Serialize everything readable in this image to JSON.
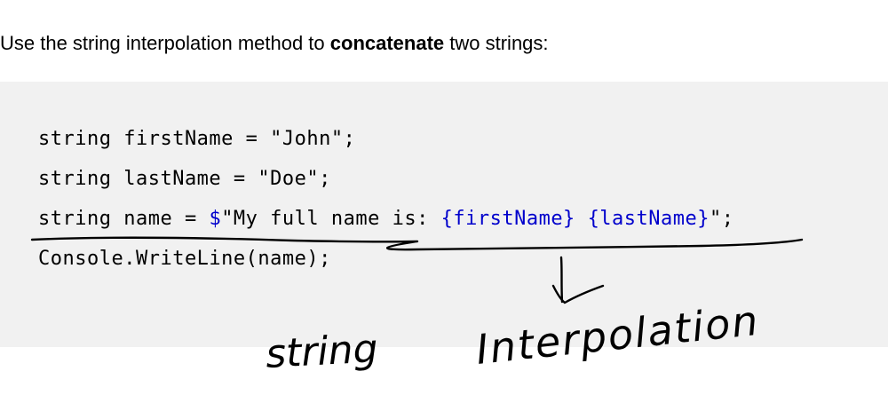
{
  "intro": {
    "text_before": "Use the string interpolation method to ",
    "bold": "concatenate",
    "text_after": " two strings:"
  },
  "code": {
    "line1": "string firstName = \"John\";",
    "line2": "string lastName = \"Doe\";",
    "line3_a": "string name = ",
    "line3_dollar": "$",
    "line3_b": "\"My full name is: ",
    "line3_var1": "{firstName}",
    "line3_space": " ",
    "line3_var2": "{lastName}",
    "line3_c": "\";",
    "line4": "Console.WriteLine(name);"
  },
  "handwriting": {
    "word1": "string",
    "word2": "Interpolation"
  },
  "colors": {
    "code_bg": "#f1f1f1",
    "interpolation_blue": "#0000cc",
    "ink": "#000000"
  }
}
